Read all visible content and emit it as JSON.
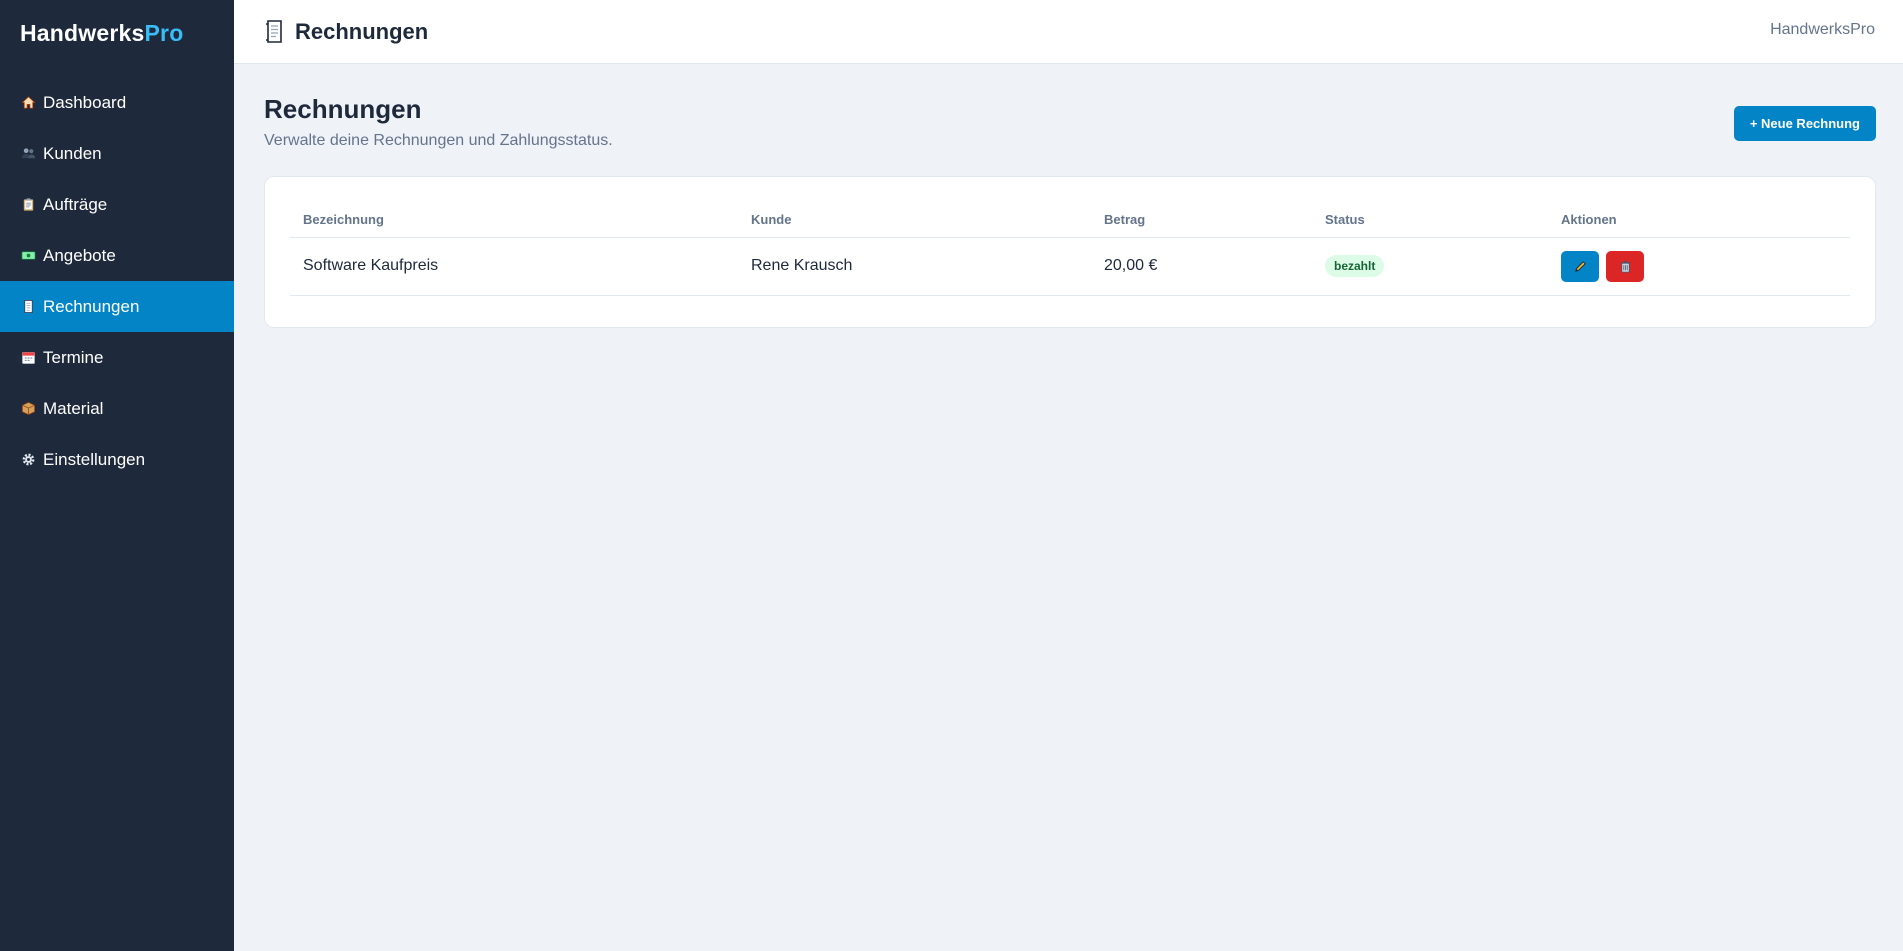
{
  "brand": {
    "name_main": "Handwerks",
    "name_accent": "Pro"
  },
  "sidebar": {
    "items": [
      {
        "label": "Dashboard",
        "icon": "house-icon",
        "active": false
      },
      {
        "label": "Kunden",
        "icon": "people-icon",
        "active": false
      },
      {
        "label": "Aufträge",
        "icon": "clipboard-icon",
        "active": false
      },
      {
        "label": "Angebote",
        "icon": "banknote-icon",
        "active": false
      },
      {
        "label": "Rechnungen",
        "icon": "receipt-icon",
        "active": true
      },
      {
        "label": "Termine",
        "icon": "calendar-icon",
        "active": false
      },
      {
        "label": "Material",
        "icon": "package-icon",
        "active": false
      },
      {
        "label": "Einstellungen",
        "icon": "gear-icon",
        "active": false
      }
    ]
  },
  "topbar": {
    "title": "Rechnungen",
    "title_icon": "receipt-icon",
    "app_name": "HandwerksPro"
  },
  "page": {
    "title": "Rechnungen",
    "subtitle": "Verwalte deine Rechnungen und Zahlungsstatus.",
    "new_button_label": "+ Neue Rechnung"
  },
  "table": {
    "headers": {
      "bezeichnung": "Bezeichnung",
      "kunde": "Kunde",
      "betrag": "Betrag",
      "status": "Status",
      "aktionen": "Aktionen"
    },
    "rows": [
      {
        "bezeichnung": "Software Kaufpreis",
        "kunde": "Rene Krausch",
        "betrag": "20,00 €",
        "status": "bezahlt"
      }
    ]
  },
  "colors": {
    "sidebar_bg": "#1e293b",
    "accent": "#0284c7",
    "brand_accent": "#38bdf8",
    "danger": "#dc2626",
    "badge_bg": "#dcfce7",
    "badge_text": "#166534"
  }
}
